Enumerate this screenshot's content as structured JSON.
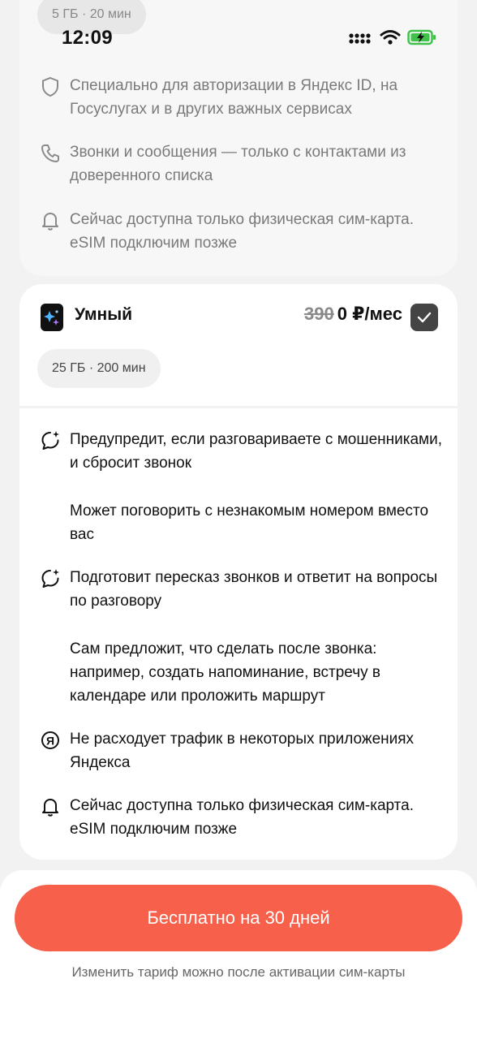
{
  "status_bar": {
    "time": "12:09"
  },
  "top_card": {
    "pill": "5 ГБ · 20 мин",
    "features": [
      {
        "icon": "shield-icon",
        "text": "Специально для авторизации в Яндекс ID, на Госуслугах и в других важных сервисах"
      },
      {
        "icon": "phone-icon",
        "text": "Звонки и сообщения — только с контактами из доверенного списка"
      },
      {
        "icon": "bell-icon",
        "text": "Сейчас доступна только физическая сим-карта. eSIM подключим позже"
      }
    ]
  },
  "plan_card": {
    "title": "Умный",
    "old_price": "390",
    "price": "0 ₽/мес",
    "pill": "25 ГБ · 200 мин",
    "features": [
      {
        "icon": "ai-chat-icon",
        "text": "Предупредит, если разговариваете с мошенниками, и сбросит звонок"
      },
      {
        "icon": "",
        "text": "Может поговорить с незнакомым номером вместо вас"
      },
      {
        "icon": "ai-chat-icon",
        "text": "Подготовит пересказ звонков и ответит на вопросы по разговору"
      },
      {
        "icon": "",
        "text": "Сам предложит, что сделать после звонка: например, создать напоминание, встречу в календаре или проложить маршрут"
      },
      {
        "icon": "yandex-icon",
        "text": "Не расходует трафик в некоторых приложениях Яндекса"
      },
      {
        "icon": "bell-icon",
        "text": "Сейчас доступна только физическая сим-карта. eSIM подключим позже"
      }
    ]
  },
  "bottom": {
    "cta_label": "Бесплатно на 30 дней",
    "hint": "Изменить тариф можно после активации сим-карты"
  },
  "colors": {
    "cta": "#f7604a",
    "check_bg": "#444444",
    "battery": "#3fc14a"
  }
}
